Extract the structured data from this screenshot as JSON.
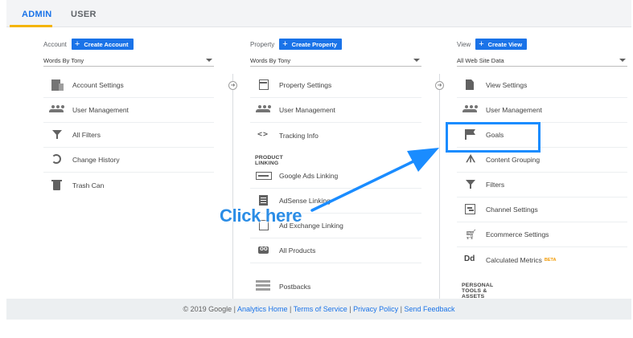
{
  "tabs": [
    {
      "label": "ADMIN",
      "active": true
    },
    {
      "label": "USER",
      "active": false
    }
  ],
  "columns": [
    {
      "label": "Account",
      "create_label": "Create Account",
      "selected": "Words By Tony",
      "items": [
        {
          "label": "Account Settings",
          "icon": "building-icon"
        },
        {
          "label": "User Management",
          "icon": "people-icon"
        },
        {
          "label": "All Filters",
          "icon": "filter-icon"
        },
        {
          "label": "Change History",
          "icon": "history-icon"
        },
        {
          "label": "Trash Can",
          "icon": "trash-icon"
        }
      ]
    },
    {
      "label": "Property",
      "create_label": "Create Property",
      "selected": "Words By Tony",
      "items": [
        {
          "label": "Property Settings",
          "icon": "settings-square-icon"
        },
        {
          "label": "User Management",
          "icon": "people-icon"
        },
        {
          "label": "Tracking Info",
          "icon": "code-icon"
        }
      ],
      "section_header": "PRODUCT LINKING",
      "linking_items": [
        {
          "label": "Google Ads Linking",
          "icon": "ads-icon"
        },
        {
          "label": "AdSense Linking",
          "icon": "adsense-icon"
        },
        {
          "label": "Ad Exchange Linking",
          "icon": "ad-exchange-icon"
        },
        {
          "label": "All Products",
          "icon": "all-products-icon"
        },
        {
          "label": "Postbacks",
          "icon": "postbacks-icon"
        }
      ]
    },
    {
      "label": "View",
      "create_label": "Create View",
      "selected": "All Web Site Data",
      "items": [
        {
          "label": "View Settings",
          "icon": "document-icon"
        },
        {
          "label": "User Management",
          "icon": "people-icon"
        },
        {
          "label": "Goals",
          "icon": "flag-icon"
        },
        {
          "label": "Content Grouping",
          "icon": "content-grouping-icon"
        },
        {
          "label": "Filters",
          "icon": "filter-icon"
        },
        {
          "label": "Channel Settings",
          "icon": "channel-icon"
        },
        {
          "label": "Ecommerce Settings",
          "icon": "cart-icon"
        },
        {
          "label": "Calculated Metrics",
          "icon": "dd-icon",
          "badge": "BETA"
        }
      ],
      "section_header": "PERSONAL TOOLS & ASSETS"
    }
  ],
  "callout": {
    "text": "Click here",
    "color": "#2b8de6"
  },
  "footer": {
    "copyright": "© 2019 Google |",
    "links": [
      "Analytics Home",
      "Terms of Service",
      "Privacy Policy",
      "Send Feedback"
    ],
    "separator": "|"
  },
  "colors": {
    "accent": "#1a73e8",
    "tab_underline": "#f4b400",
    "highlight": "#1a8cff"
  }
}
